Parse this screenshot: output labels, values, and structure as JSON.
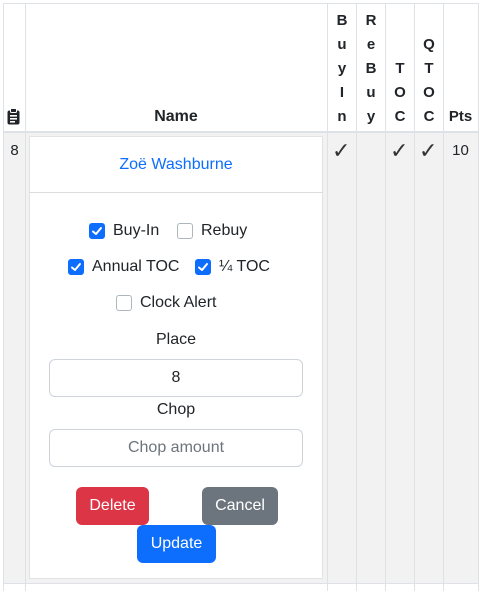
{
  "table": {
    "headers": {
      "name": "Name",
      "buyin_chars": [
        "B",
        "u",
        "y",
        "I",
        "n"
      ],
      "rebuy_chars": [
        "R",
        "e",
        "B",
        "u",
        "y"
      ],
      "toc_chars": [
        "T",
        "O",
        "C"
      ],
      "qtoc_chars": [
        "Q",
        "T",
        "O",
        "C"
      ],
      "pts": "Pts"
    },
    "row": {
      "place": "8",
      "buyin_check": "✓",
      "toc_check": "✓",
      "qtoc_check": "✓",
      "pts": "10"
    }
  },
  "editor": {
    "player_name": "Zoë Washburne",
    "checkboxes": {
      "buyin": {
        "label": "Buy-In",
        "checked": true
      },
      "rebuy": {
        "label": "Rebuy",
        "checked": false
      },
      "annual_toc": {
        "label": "Annual TOC",
        "checked": true
      },
      "quarter_toc": {
        "label": "¼ TOC",
        "checked": true
      },
      "clock_alert": {
        "label": "Clock Alert",
        "checked": false
      }
    },
    "place_label": "Place",
    "place_value": "8",
    "chop_label": "Chop",
    "chop_placeholder": "Chop amount",
    "buttons": {
      "delete": "Delete",
      "cancel": "Cancel",
      "update": "Update"
    }
  },
  "colors": {
    "primary": "#0d6efd",
    "danger": "#dc3545",
    "secondary": "#6c757d"
  },
  "icons": {
    "header_first_col": "clipboard-icon"
  }
}
